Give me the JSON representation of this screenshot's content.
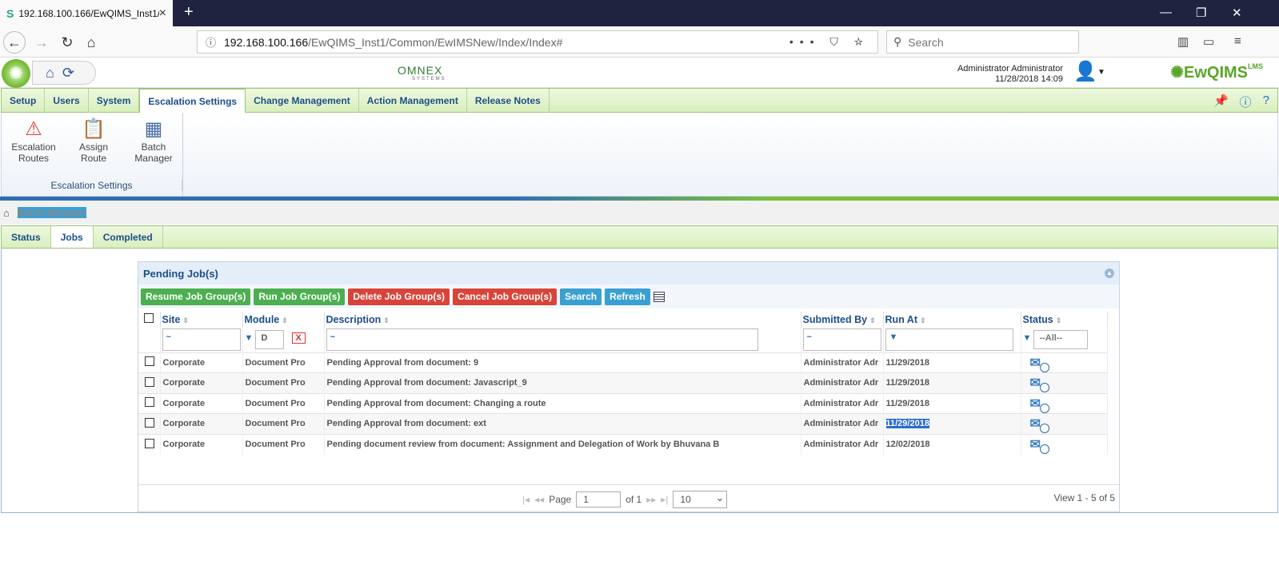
{
  "browser": {
    "tab_title": "192.168.100.166/EwQIMS_Inst1/",
    "url_host": "192.168.100.166",
    "url_path": "/EwQIMS_Inst1/Common/EwIMSNew/Index/Index#",
    "search_placeholder": "Search"
  },
  "header": {
    "logo": "OMNEX",
    "logo_sub": "SYSTEMS",
    "user": "Administrator Administrator",
    "datetime": "11/28/2018 14:09",
    "brand": "EwQIMS",
    "brand_sup": "LMS"
  },
  "menu": [
    {
      "label": "Setup"
    },
    {
      "label": "Users"
    },
    {
      "label": "System"
    },
    {
      "label": "Escalation Settings"
    },
    {
      "label": "Change Management"
    },
    {
      "label": "Action Management"
    },
    {
      "label": "Release Notes"
    }
  ],
  "ribbon": {
    "buttons": [
      {
        "label": "Escalation Routes",
        "icon": "escalation-routes-icon"
      },
      {
        "label": "Assign Route",
        "icon": "assign-route-icon"
      },
      {
        "label": "Batch Manager",
        "icon": "batch-manager-icon"
      }
    ],
    "group": "Escalation Settings"
  },
  "breadcrumb": {
    "page": "Batch Manager"
  },
  "subtabs": [
    {
      "label": "Status"
    },
    {
      "label": "Jobs"
    },
    {
      "label": "Completed"
    }
  ],
  "panel": {
    "title": "Pending Job(s)"
  },
  "toolbar": {
    "resume": "Resume Job Group(s)",
    "run": "Run Job Group(s)",
    "delete": "Delete Job Group(s)",
    "cancel": "Cancel Job Group(s)",
    "search": "Search",
    "refresh": "Refresh"
  },
  "columns": {
    "site": "Site",
    "module": "Module",
    "description": "Description",
    "submitted_by": "Submitted By",
    "run_at": "Run At",
    "status": "Status"
  },
  "filters": {
    "site": "~",
    "module": "D",
    "description": "~",
    "submitted_by": "~",
    "status": "--All--",
    "clear": "X"
  },
  "rows": [
    {
      "site": "Corporate",
      "module": "Document Pro",
      "description": "Pending Approval from document: 9",
      "submitted_by": "Administrator Adr",
      "run_at": "11/29/2018"
    },
    {
      "site": "Corporate",
      "module": "Document Pro",
      "description": "Pending Approval from document: Javascript_9",
      "submitted_by": "Administrator Adr",
      "run_at": "11/29/2018"
    },
    {
      "site": "Corporate",
      "module": "Document Pro",
      "description": "Pending Approval from document: Changing a route",
      "submitted_by": "Administrator Adr",
      "run_at": "11/29/2018"
    },
    {
      "site": "Corporate",
      "module": "Document Pro",
      "description": "Pending Approval from document: ext",
      "submitted_by": "Administrator Adr",
      "run_at": "11/29/2018"
    },
    {
      "site": "Corporate",
      "module": "Document Pro",
      "description": "Pending document review from document: Assignment and Delegation of Work by Bhuvana  B",
      "submitted_by": "Administrator Adr",
      "run_at": "12/02/2018"
    }
  ],
  "pager": {
    "page_label": "Page",
    "page": "1",
    "of": "of 1",
    "page_size": "10",
    "view": "View 1 - 5 of 5"
  }
}
